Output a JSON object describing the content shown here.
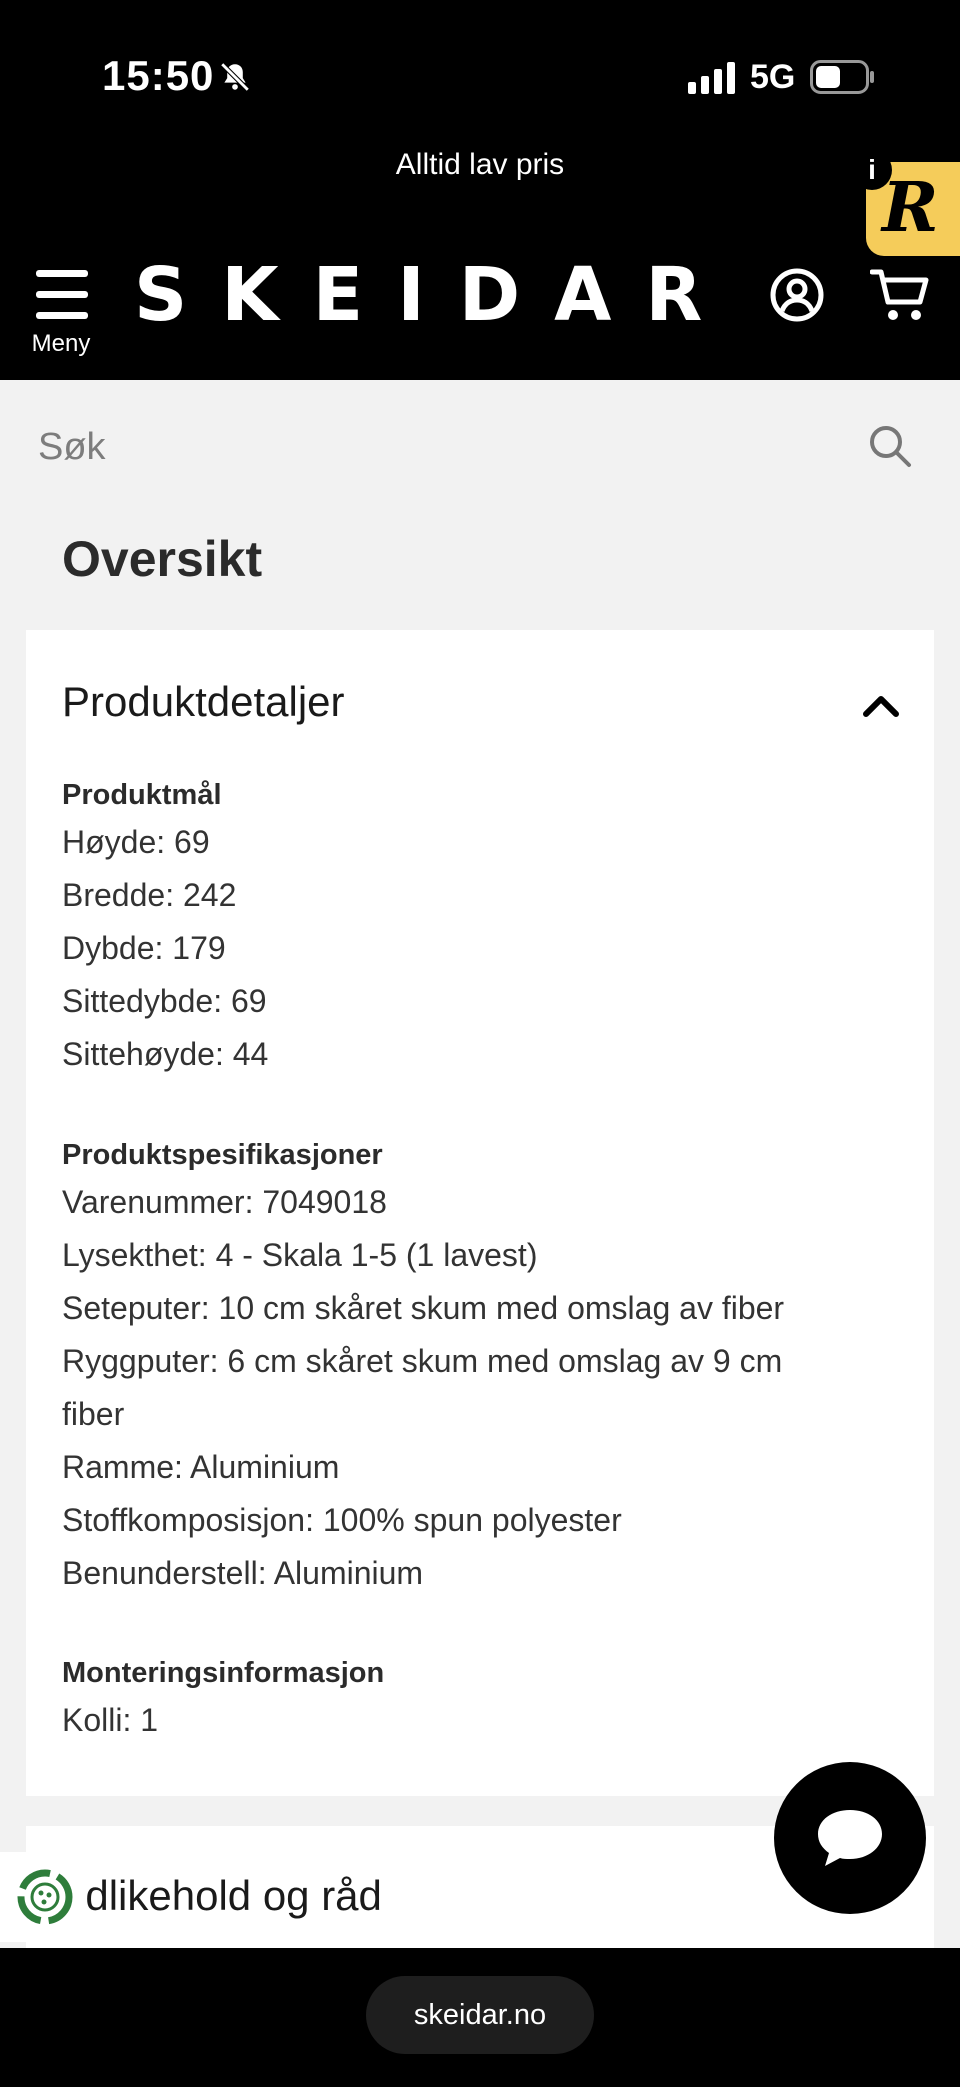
{
  "status": {
    "time": "15:50",
    "network": "5G"
  },
  "header": {
    "promo": "Alltid lav pris",
    "badge_letter": "R",
    "info": "i",
    "menu_label": "Meny",
    "logo": "SKEIDAR"
  },
  "search": {
    "placeholder": "Søk"
  },
  "overview_title": "Oversikt",
  "product_details": {
    "title": "Produktdetaljer",
    "expanded": true,
    "dimensions": {
      "heading": "Produktmål",
      "lines": [
        "Høyde: 69",
        "Bredde: 242",
        "Dybde: 179",
        "Sittedybde: 69",
        "Sittehøyde: 44"
      ]
    },
    "specs": {
      "heading": "Produktspesifikasjoner",
      "lines": [
        "Varenummer: 7049018",
        "Lysekthet: 4 - Skala 1-5 (1 lavest)",
        "Seteputer: 10 cm skåret skum med omslag av fiber",
        "Ryggputer: 6 cm skåret skum med omslag av 9 cm",
        "fiber",
        "Ramme: Aluminium",
        "Stoffkomposisjon: 100% spun polyester",
        "Benunderstell: Aluminium"
      ]
    },
    "assembly": {
      "heading": "Monteringsinformasjon",
      "lines": [
        "Kolli: 1"
      ]
    }
  },
  "care_card": {
    "title": "edlikehold og råd"
  },
  "browser": {
    "url": "skeidar.no"
  },
  "colors": {
    "header_bg": "#000000",
    "badge": "#f5cc5a",
    "eco_green": "#2e7d3b"
  }
}
